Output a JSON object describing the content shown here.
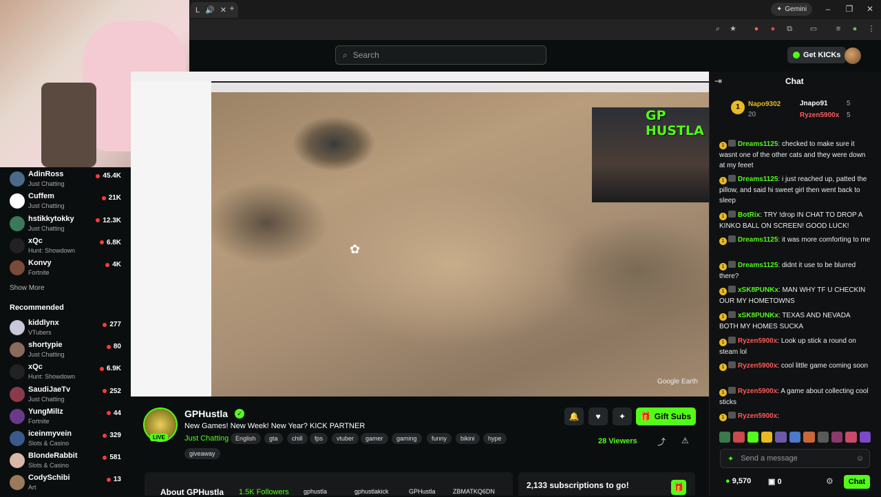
{
  "browser": {
    "tab_label": "L",
    "gemini_label": "Gemini"
  },
  "header": {
    "search_placeholder": "Search",
    "get_kicks_label": "Get KICKs"
  },
  "sidebar": {
    "following": [
      {
        "name": "AdinRoss",
        "category": "Just Chatting",
        "viewers": "45.4K",
        "color": "#4a6a8a"
      },
      {
        "name": "Cuffem",
        "category": "Just Chatting",
        "viewers": "21K",
        "color": "#ffffff"
      },
      {
        "name": "hstikkytokky",
        "category": "Just Chatting",
        "viewers": "12.3K",
        "color": "#3a7a5a"
      },
      {
        "name": "xQc",
        "category": "Hunt: Showdown",
        "viewers": "6.8K",
        "color": "#222222"
      },
      {
        "name": "Konvy",
        "category": "Fortnite",
        "viewers": "4K",
        "color": "#7a4a3a"
      }
    ],
    "show_more": "Show More",
    "recommended_title": "Recommended",
    "recommended": [
      {
        "name": "kiddlynx",
        "category": "VTubers",
        "viewers": "277",
        "color": "#c8c8d8"
      },
      {
        "name": "shortypie",
        "category": "Just Chatting",
        "viewers": "80",
        "color": "#8a6a5a"
      },
      {
        "name": "xQc",
        "category": "Hunt: Showdown",
        "viewers": "6.9K",
        "color": "#222222"
      },
      {
        "name": "SaudiJaeTv",
        "category": "Just Chatting",
        "viewers": "252",
        "color": "#8a3a4a"
      },
      {
        "name": "YungMilIz",
        "category": "Fortnite",
        "viewers": "44",
        "color": "#6a3a8a"
      },
      {
        "name": "iceinmyvein",
        "category": "Slots & Casino",
        "viewers": "329",
        "color": "#3a5a8a"
      },
      {
        "name": "BlondeRabbit",
        "category": "Slots & Casino",
        "viewers": "581",
        "color": "#d8b8a8"
      },
      {
        "name": "CodySchibi",
        "category": "Art",
        "viewers": "13",
        "color": "#9a7a5a"
      }
    ]
  },
  "player": {
    "overlay_text": "GP HUSTLA",
    "watermark": "Google Earth"
  },
  "stream": {
    "streamer_name": "GPHustla",
    "live_badge": "LIVE",
    "title": "New Games! New Week! New Year? KICK PARTNER",
    "category": "Just Chatting",
    "tags": [
      "English",
      "gta",
      "chill",
      "fps",
      "vtuber",
      "gamer",
      "gaming",
      "funny",
      "bikini",
      "hype",
      "giveaway"
    ],
    "gift_subs_label": "Gift Subs",
    "viewers": "28 Viewers",
    "about_title": "About GPHustla",
    "followers": "1.5K Followers",
    "socials": [
      "gphustla",
      "gphustlakick",
      "GPHustla",
      "ZBMATKQ6DN"
    ],
    "subs_goal": "2,133 subscriptions to go!"
  },
  "chat": {
    "title": "Chat",
    "pinned": [
      {
        "user": "Napo9302",
        "value": "20"
      },
      {
        "user": "Jnapo91",
        "value": "5"
      },
      {
        "user": "Ryzen5900x",
        "value": "5"
      }
    ],
    "messages": [
      {
        "user": "Dreams1125",
        "color": "#53fc18",
        "text": " checked to make sure it wasnt one of the other cats and they were down at my feeet"
      },
      {
        "user": "Dreams1125",
        "color": "#53fc18",
        "text": " i just reached up, patted the pillow, and said hi sweet girl then went back to sleep"
      },
      {
        "user": "BotRix",
        "color": "#53fc18",
        "text": " TRY !drop IN CHAT TO DROP A KINKO BALL ON SCREEN! GOOD LUCK!"
      },
      {
        "user": "Dreams1125",
        "color": "#53fc18",
        "text": " it was more comforting to me"
      },
      {
        "user": "Dreams1125",
        "color": "#53fc18",
        "text": " didnt it use to be blurred there?"
      },
      {
        "user": "xSK8PUNKx",
        "color": "#53fc18",
        "text": " MAN WHY TF U CHECKIN OUR MY HOMETOWNS"
      },
      {
        "user": "xSK8PUNKx",
        "color": "#53fc18",
        "text": " TEXAS AND NEVADA BOTH MY HOMES SUCKA"
      },
      {
        "user": "Ryzen5900x",
        "color": "#ff5a5a",
        "text": " Look up stick a round on steam lol"
      },
      {
        "user": "Ryzen5900x",
        "color": "#ff5a5a",
        "text": " cool little game coming soon"
      },
      {
        "user": "Ryzen5900x",
        "color": "#ff5a5a",
        "text": " A game about collecting cool sticks"
      },
      {
        "user": "Ryzen5900x",
        "color": "#ff5a5a",
        "text": ""
      }
    ],
    "input_placeholder": "Send a message",
    "kicks_balance": "9,570",
    "gift_balance": "0",
    "send_label": "Chat"
  }
}
